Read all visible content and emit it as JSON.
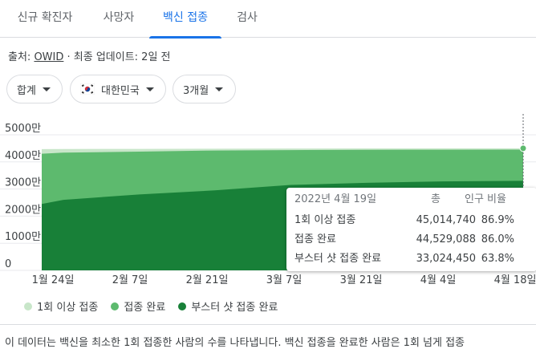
{
  "tabs": [
    {
      "label": "신규 확진자"
    },
    {
      "label": "사망자"
    },
    {
      "label": "백신 접종"
    },
    {
      "label": "검사"
    }
  ],
  "source": {
    "prefix": "출처: ",
    "link": "OWID",
    "suffix": " · 최종 업데이트: 2일 전"
  },
  "filters": {
    "metric": "합계",
    "region": "대한민국",
    "period": "3개월"
  },
  "icons": {
    "flag": "south-korea-flag-icon",
    "caret": "caret-down-icon"
  },
  "colors": {
    "at_least_one": "#c8e6c9",
    "fully": "#5dba6e",
    "booster": "#188038",
    "accent": "#1a73e8"
  },
  "chart_data": {
    "type": "area",
    "yticks": [
      "5000만",
      "4000만",
      "3000만",
      "2000만",
      "1000만",
      "0"
    ],
    "ylim": [
      0,
      50000000
    ],
    "xticks": [
      "1월 24일",
      "2월 7일",
      "2월 21일",
      "3월 7일",
      "3월 21일",
      "4월 4일",
      "4월 18일"
    ],
    "x": [
      "2022-01-20",
      "2022-01-24",
      "2022-02-07",
      "2022-02-21",
      "2022-03-07",
      "2022-03-21",
      "2022-04-04",
      "2022-04-19"
    ],
    "series": [
      {
        "name": "1회 이상 접종",
        "values": [
          44700000,
          44750000,
          44800000,
          44860000,
          44920000,
          44960000,
          44990000,
          45014740
        ]
      },
      {
        "name": "접종 완료",
        "values": [
          43000000,
          43400000,
          43800000,
          44200000,
          44350000,
          44440000,
          44500000,
          44529088
        ]
      },
      {
        "name": "부스터 샷 접종 완료",
        "values": [
          24500000,
          26000000,
          28000000,
          29500000,
          31500000,
          32300000,
          32800000,
          33024450
        ]
      }
    ],
    "legend": [
      "1회 이상 접종",
      "접종 완료",
      "부스터 샷 접종 완료"
    ],
    "grid": true,
    "legend_position": "bottom-left"
  },
  "tooltip": {
    "date": "2022년 4월 19일",
    "col_total": "총",
    "col_pct": "인구 비율",
    "rows": [
      {
        "label": "1회 이상 접종",
        "total": "45,014,740",
        "pct": "86.9%"
      },
      {
        "label": "접종 완료",
        "total": "44,529,088",
        "pct": "86.0%"
      },
      {
        "label": "부스터 샷 접종 완료",
        "total": "33,024,450",
        "pct": "63.8%"
      }
    ]
  },
  "note": "이 데이터는 백신을 최소한 1회 접종한 사람의 수를 나타냅니다. 백신 접종을 완료한 사람은 1회 넘게 접종"
}
